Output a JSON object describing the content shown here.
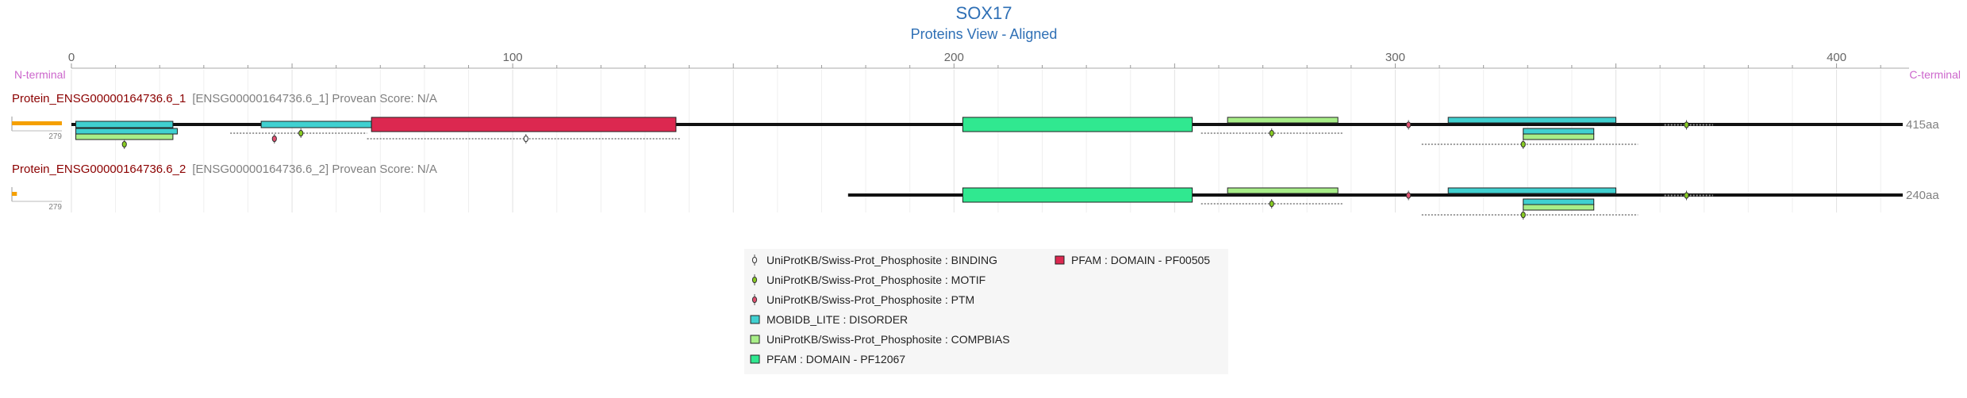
{
  "title": "SOX17",
  "subtitle": "Proteins View - Aligned",
  "n_terminal": "N-terminal",
  "c_terminal": "C-terminal",
  "colors": {
    "title": "#2e6fb5",
    "terminal": "#cc66cc",
    "protein_name": "#8b0000",
    "disorder": "#40d0d0",
    "compbias": "#a8ee88",
    "pf12067": "#30e890",
    "pf00505": "#dc2850",
    "binding": "#f5f5f5",
    "motif": "#88cc22",
    "ptm": "#e05070",
    "score_bar": "#f5a000"
  },
  "chart_data": {
    "type": "protein-domain-map",
    "x_range": [
      0,
      415
    ],
    "ticks": [
      0,
      100,
      200,
      300,
      400
    ],
    "proteins": [
      {
        "name": "Protein_ENSG00000164736.6_1",
        "info": "[ENSG00000164736.6_1] Provean Score: N/A",
        "length_label": "415aa",
        "score_label": "279",
        "score_fraction": 1.0,
        "backbone": [
          0,
          415
        ],
        "domains": [
          {
            "type": "disorder",
            "start": 1,
            "end": 23,
            "row": 0
          },
          {
            "type": "disorder",
            "start": 1,
            "end": 24,
            "row": 1
          },
          {
            "type": "compbias",
            "start": 1,
            "end": 23,
            "row": 2
          },
          {
            "type": "disorder",
            "start": 43,
            "end": 68,
            "row": 0
          },
          {
            "type": "pf00505",
            "start": 68,
            "end": 137,
            "row": 0
          },
          {
            "type": "pf12067",
            "start": 202,
            "end": 254,
            "row": 0
          },
          {
            "type": "compbias",
            "start": 262,
            "end": 287,
            "row": -1
          },
          {
            "type": "disorder",
            "start": 312,
            "end": 350,
            "row": -1
          },
          {
            "type": "disorder",
            "start": 329,
            "end": 345,
            "row": 1
          },
          {
            "type": "compbias",
            "start": 329,
            "end": 345,
            "row": 2
          }
        ],
        "sites": [
          {
            "type": "motif",
            "pos": 12,
            "row": 3
          },
          {
            "type": "ptm",
            "pos": 46,
            "row": 2
          },
          {
            "type": "motif",
            "pos": 52,
            "row": 1
          },
          {
            "type": "binding",
            "pos": 103,
            "row": 2
          },
          {
            "type": "motif",
            "pos": 272,
            "row": 1
          },
          {
            "type": "ptm",
            "pos": 303,
            "row": -0.5
          },
          {
            "type": "motif",
            "pos": 329,
            "row": 3
          },
          {
            "type": "motif",
            "pos": 366,
            "row": -0.5
          }
        ],
        "dotted": [
          {
            "start": 36,
            "end": 67,
            "row": 1
          },
          {
            "start": 67,
            "end": 138,
            "row": 2
          },
          {
            "start": 256,
            "end": 288,
            "row": 1
          },
          {
            "start": 306,
            "end": 355,
            "row": 3
          },
          {
            "start": 361,
            "end": 372,
            "row": -0.5
          }
        ]
      },
      {
        "name": "Protein_ENSG00000164736.6_2",
        "info": "[ENSG00000164736.6_2] Provean Score: N/A",
        "length_label": "240aa",
        "score_label": "279",
        "score_fraction": 0.1,
        "backbone": [
          176,
          415
        ],
        "domains": [
          {
            "type": "pf12067",
            "start": 202,
            "end": 254,
            "row": 0
          },
          {
            "type": "compbias",
            "start": 262,
            "end": 287,
            "row": -1
          },
          {
            "type": "disorder",
            "start": 312,
            "end": 350,
            "row": -1
          },
          {
            "type": "disorder",
            "start": 329,
            "end": 345,
            "row": 1
          },
          {
            "type": "compbias",
            "start": 329,
            "end": 345,
            "row": 2
          }
        ],
        "sites": [
          {
            "type": "motif",
            "pos": 272,
            "row": 1
          },
          {
            "type": "ptm",
            "pos": 303,
            "row": -0.5
          },
          {
            "type": "motif",
            "pos": 329,
            "row": 3
          },
          {
            "type": "motif",
            "pos": 366,
            "row": -0.5
          }
        ],
        "dotted": [
          {
            "start": 256,
            "end": 288,
            "row": 1
          },
          {
            "start": 306,
            "end": 355,
            "row": 3
          },
          {
            "start": 361,
            "end": 372,
            "row": -0.5
          }
        ]
      }
    ],
    "legend": [
      {
        "key": "binding",
        "shape": "site",
        "label": "UniProtKB/Swiss-Prot_Phosphosite : BINDING",
        "col": 0
      },
      {
        "key": "motif",
        "shape": "site",
        "label": "UniProtKB/Swiss-Prot_Phosphosite : MOTIF",
        "col": 0
      },
      {
        "key": "ptm",
        "shape": "site",
        "label": "UniProtKB/Swiss-Prot_Phosphosite : PTM",
        "col": 0
      },
      {
        "key": "disorder",
        "shape": "box",
        "label": "MOBIDB_LITE : DISORDER",
        "col": 0
      },
      {
        "key": "compbias",
        "shape": "box",
        "label": "UniProtKB/Swiss-Prot_Phosphosite : COMPBIAS",
        "col": 0
      },
      {
        "key": "pf12067",
        "shape": "box",
        "label": "PFAM : DOMAIN - PF12067",
        "col": 0
      },
      {
        "key": "pf00505",
        "shape": "box",
        "label": "PFAM : DOMAIN - PF00505",
        "col": 1
      }
    ]
  }
}
